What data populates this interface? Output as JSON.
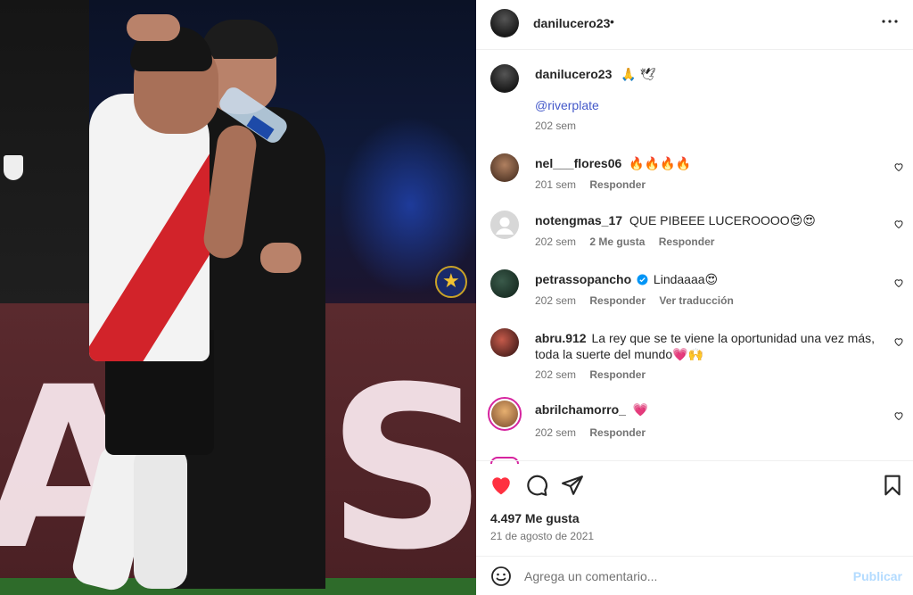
{
  "post": {
    "username": "danilucero23",
    "header_dot": "•",
    "caption_emojis": "🙏 🕊",
    "caption_mention": "@riverplate",
    "caption_time": "202 sem"
  },
  "comments": [
    {
      "user": "nel___flores06",
      "text": "🔥🔥🔥🔥",
      "time": "201 sem",
      "likes": "",
      "actions": [
        "Responder"
      ]
    },
    {
      "user": "notengmas_17",
      "text": "QUE PIBEEE LUCEROOOO😍😍",
      "time": "202 sem",
      "likes": "2 Me gusta",
      "actions": [
        "Responder"
      ]
    },
    {
      "user": "petrassopancho",
      "verified": true,
      "text": "Lindaaaa😍",
      "time": "202 sem",
      "likes": "",
      "actions": [
        "Responder",
        "Ver traducción"
      ]
    },
    {
      "user": "abru.912",
      "text": "La rey que se te viene la oportunidad una vez más, toda la suerte del mundo💗🙌",
      "time": "202 sem",
      "likes": "",
      "actions": [
        "Responder"
      ]
    },
    {
      "user": "abrilchamorro_",
      "text": "💗",
      "time": "202 sem",
      "likes": "",
      "actions": [
        "Responder"
      ]
    }
  ],
  "footer": {
    "likes": "4.497 Me gusta",
    "date": "21 de agosto de 2021",
    "add_comment_placeholder": "Agrega un comentario...",
    "publish": "Publicar"
  },
  "photo": {
    "led_text": "AYS"
  },
  "colors": {
    "like_red": "#ff3040",
    "mention_blue": "#4358c9",
    "publish_disabled": "#b3dbff",
    "verified_blue": "#0095f6"
  },
  "icons": [
    "more-icon",
    "heart-icon",
    "comment-icon",
    "share-icon",
    "bookmark-icon",
    "emoji-icon",
    "verified-icon"
  ]
}
